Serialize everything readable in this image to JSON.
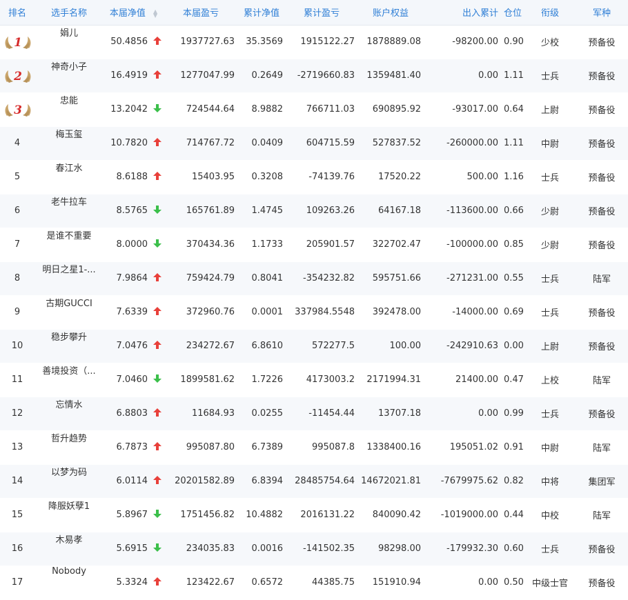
{
  "colors": {
    "header_text": "#2f7fd6",
    "up": "#e8403a",
    "down": "#3bbf4a",
    "gold": "#c9a46a",
    "medal_num": "#d62b2b"
  },
  "headers": {
    "rank": "排名",
    "name": "选手名称",
    "nav": "本届净值",
    "pnl": "本届盈亏",
    "cum_nav": "累计净值",
    "cum_pnl": "累计盈亏",
    "equity": "账户权益",
    "flow": "出入累计",
    "position": "仓位",
    "rank_title": "衔级",
    "branch": "军种"
  },
  "rows": [
    {
      "rank": "1",
      "medal": true,
      "name": "娟儿",
      "nav": "50.4856",
      "trend": "up",
      "pnl": "1937727.63",
      "cum_nav": "35.3569",
      "cum_pnl": "1915122.27",
      "equity": "1878889.08",
      "flow": "-98200.00",
      "position": "0.90",
      "rank_title": "少校",
      "branch": "预备役"
    },
    {
      "rank": "2",
      "medal": true,
      "name": "神奇小子",
      "nav": "16.4919",
      "trend": "up",
      "pnl": "1277047.99",
      "cum_nav": "0.2649",
      "cum_pnl": "-2719660.83",
      "equity": "1359481.40",
      "flow": "0.00",
      "position": "1.11",
      "rank_title": "士兵",
      "branch": "预备役"
    },
    {
      "rank": "3",
      "medal": true,
      "name": "忠能",
      "nav": "13.2042",
      "trend": "down",
      "pnl": "724544.64",
      "cum_nav": "8.9882",
      "cum_pnl": "766711.03",
      "equity": "690895.92",
      "flow": "-93017.00",
      "position": "0.64",
      "rank_title": "上尉",
      "branch": "预备役"
    },
    {
      "rank": "4",
      "medal": false,
      "name": "梅玉玺",
      "nav": "10.7820",
      "trend": "up",
      "pnl": "714767.72",
      "cum_nav": "0.0409",
      "cum_pnl": "604715.59",
      "equity": "527837.52",
      "flow": "-260000.00",
      "position": "1.11",
      "rank_title": "中尉",
      "branch": "预备役"
    },
    {
      "rank": "5",
      "medal": false,
      "name": "春江水",
      "nav": "8.6188",
      "trend": "up",
      "pnl": "15403.95",
      "cum_nav": "0.3208",
      "cum_pnl": "-74139.76",
      "equity": "17520.22",
      "flow": "500.00",
      "position": "1.16",
      "rank_title": "士兵",
      "branch": "预备役"
    },
    {
      "rank": "6",
      "medal": false,
      "name": "老牛拉车",
      "nav": "8.5765",
      "trend": "down",
      "pnl": "165761.89",
      "cum_nav": "1.4745",
      "cum_pnl": "109263.26",
      "equity": "64167.18",
      "flow": "-113600.00",
      "position": "0.66",
      "rank_title": "少尉",
      "branch": "预备役"
    },
    {
      "rank": "7",
      "medal": false,
      "name": "是谁不重要",
      "nav": "8.0000",
      "trend": "down",
      "pnl": "370434.36",
      "cum_nav": "1.1733",
      "cum_pnl": "205901.57",
      "equity": "322702.47",
      "flow": "-100000.00",
      "position": "0.85",
      "rank_title": "少尉",
      "branch": "预备役"
    },
    {
      "rank": "8",
      "medal": false,
      "name": "明日之星1-...",
      "nav": "7.9864",
      "trend": "up",
      "pnl": "759424.79",
      "cum_nav": "0.8041",
      "cum_pnl": "-354232.82",
      "equity": "595751.66",
      "flow": "-271231.00",
      "position": "0.55",
      "rank_title": "士兵",
      "branch": "陆军"
    },
    {
      "rank": "9",
      "medal": false,
      "name": "古期GUCCI",
      "nav": "7.6339",
      "trend": "up",
      "pnl": "372960.76",
      "cum_nav": "0.0001",
      "cum_pnl": "337984.5548",
      "equity": "392478.00",
      "flow": "-14000.00",
      "position": "0.69",
      "rank_title": "士兵",
      "branch": "预备役"
    },
    {
      "rank": "10",
      "medal": false,
      "name": "稳步攀升",
      "nav": "7.0476",
      "trend": "up",
      "pnl": "234272.67",
      "cum_nav": "6.8610",
      "cum_pnl": "572277.5",
      "equity": "100.00",
      "flow": "-242910.63",
      "position": "0.00",
      "rank_title": "上尉",
      "branch": "预备役"
    },
    {
      "rank": "11",
      "medal": false,
      "name": "善境投资（...",
      "nav": "7.0460",
      "trend": "down",
      "pnl": "1899581.62",
      "cum_nav": "1.7226",
      "cum_pnl": "4173003.2",
      "equity": "2171994.31",
      "flow": "21400.00",
      "position": "0.47",
      "rank_title": "上校",
      "branch": "陆军"
    },
    {
      "rank": "12",
      "medal": false,
      "name": "忘情水",
      "nav": "6.8803",
      "trend": "up",
      "pnl": "11684.93",
      "cum_nav": "0.0255",
      "cum_pnl": "-11454.44",
      "equity": "13707.18",
      "flow": "0.00",
      "position": "0.99",
      "rank_title": "士兵",
      "branch": "预备役"
    },
    {
      "rank": "13",
      "medal": false,
      "name": "哲升趋势",
      "nav": "6.7873",
      "trend": "up",
      "pnl": "995087.80",
      "cum_nav": "6.7389",
      "cum_pnl": "995087.8",
      "equity": "1338400.16",
      "flow": "195051.02",
      "position": "0.91",
      "rank_title": "中尉",
      "branch": "陆军"
    },
    {
      "rank": "14",
      "medal": false,
      "name": "以梦为码",
      "nav": "6.0114",
      "trend": "up",
      "pnl": "20201582.89",
      "cum_nav": "6.8394",
      "cum_pnl": "28485754.64",
      "equity": "14672021.81",
      "flow": "-7679975.62",
      "position": "0.82",
      "rank_title": "中将",
      "branch": "集团军"
    },
    {
      "rank": "15",
      "medal": false,
      "name": "降服妖孽1",
      "nav": "5.8967",
      "trend": "down",
      "pnl": "1751456.82",
      "cum_nav": "10.4882",
      "cum_pnl": "2016131.22",
      "equity": "840090.42",
      "flow": "-1019000.00",
      "position": "0.44",
      "rank_title": "中校",
      "branch": "陆军"
    },
    {
      "rank": "16",
      "medal": false,
      "name": "木易孝",
      "nav": "5.6915",
      "trend": "down",
      "pnl": "234035.83",
      "cum_nav": "0.0016",
      "cum_pnl": "-141502.35",
      "equity": "98298.00",
      "flow": "-179932.30",
      "position": "0.60",
      "rank_title": "士兵",
      "branch": "预备役"
    },
    {
      "rank": "17",
      "medal": false,
      "name": "Nobody",
      "nav": "5.3324",
      "trend": "up",
      "pnl": "123422.67",
      "cum_nav": "0.6572",
      "cum_pnl": "44385.75",
      "equity": "151910.94",
      "flow": "0.00",
      "position": "0.50",
      "rank_title": "中级士官",
      "branch": "预备役"
    }
  ]
}
